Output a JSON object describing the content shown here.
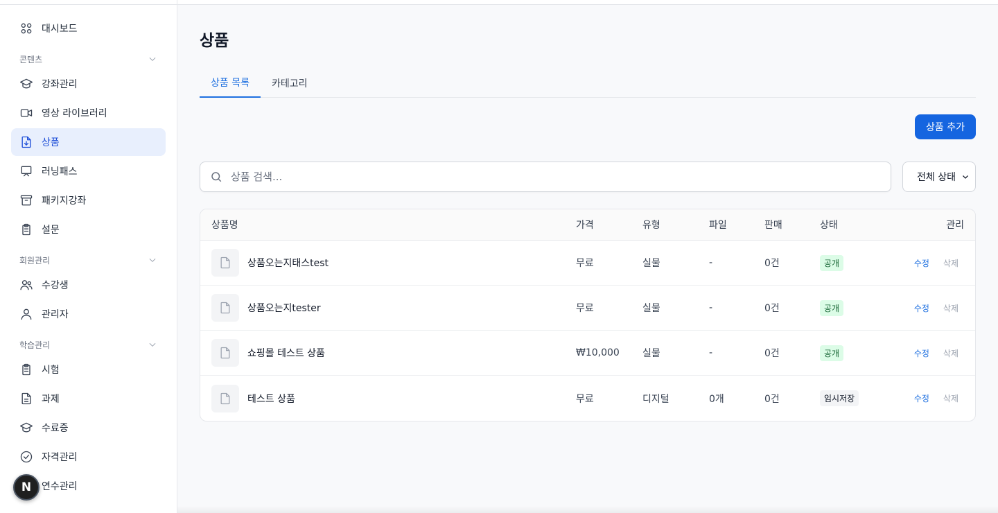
{
  "sidebar": {
    "items": [
      {
        "type": "item",
        "label": "대시보드",
        "icon": "dashboard-grid-icon",
        "name": "sidebar-item-dashboard",
        "active": false
      },
      {
        "type": "section",
        "label": "콘텐츠",
        "name": "section-content"
      },
      {
        "type": "item",
        "label": "강좌관리",
        "icon": "graduation-cap-icon",
        "name": "sidebar-item-courses",
        "active": false
      },
      {
        "type": "item",
        "label": "영상 라이브러리",
        "icon": "video-camera-icon",
        "name": "sidebar-item-video-library",
        "active": false
      },
      {
        "type": "item",
        "label": "상품",
        "icon": "file-download-icon",
        "name": "sidebar-item-products",
        "active": true
      },
      {
        "type": "item",
        "label": "러닝패스",
        "icon": "presentation-board-icon",
        "name": "sidebar-item-learning-path",
        "active": false
      },
      {
        "type": "item",
        "label": "패키지강좌",
        "icon": "archive-box-icon",
        "name": "sidebar-item-package-courses",
        "active": false
      },
      {
        "type": "item",
        "label": "설문",
        "icon": "clipboard-icon",
        "name": "sidebar-item-survey",
        "active": false
      },
      {
        "type": "section",
        "label": "회원관리",
        "name": "section-members"
      },
      {
        "type": "item",
        "label": "수강생",
        "icon": "users-icon",
        "name": "sidebar-item-students",
        "active": false
      },
      {
        "type": "item",
        "label": "관리자",
        "icon": "user-icon",
        "name": "sidebar-item-admins",
        "active": false
      },
      {
        "type": "section",
        "label": "학습관리",
        "name": "section-learning"
      },
      {
        "type": "item",
        "label": "시험",
        "icon": "clipboard-icon",
        "name": "sidebar-item-exam",
        "active": false
      },
      {
        "type": "item",
        "label": "과제",
        "icon": "file-text-icon",
        "name": "sidebar-item-assignment",
        "active": false
      },
      {
        "type": "item",
        "label": "수료증",
        "icon": "graduation-cap-icon",
        "name": "sidebar-item-certificate",
        "active": false
      },
      {
        "type": "item",
        "label": "자격관리",
        "icon": "check-circle-icon",
        "name": "sidebar-item-qualification",
        "active": false
      },
      {
        "type": "item",
        "label": "연수관리",
        "icon": "calendar-icon",
        "name": "sidebar-item-training",
        "active": false
      }
    ],
    "badge_letter": "N"
  },
  "page": {
    "title": "상품",
    "tabs": [
      {
        "label": "상품 목록",
        "active": true
      },
      {
        "label": "카테고리",
        "active": false
      }
    ],
    "add_button": "상품 추가",
    "search_placeholder": "상품 검색...",
    "status_filter": "전체 상태"
  },
  "table": {
    "headers": {
      "name": "상품명",
      "price": "가격",
      "type": "유형",
      "file": "파일",
      "sales": "판매",
      "status": "상태",
      "manage": "관리"
    },
    "rows": [
      {
        "name": "상품오는지태스test",
        "price": "무료",
        "type": "실물",
        "file": "-",
        "sales": "0건",
        "status": "공개",
        "status_kind": "public",
        "edit": "수정",
        "delete": "삭제"
      },
      {
        "name": "상품오는지tester",
        "price": "무료",
        "type": "실물",
        "file": "-",
        "sales": "0건",
        "status": "공개",
        "status_kind": "public",
        "edit": "수정",
        "delete": "삭제"
      },
      {
        "name": "쇼핑몰 테스트 상품",
        "price": "₩10,000",
        "type": "실물",
        "file": "-",
        "sales": "0건",
        "status": "공개",
        "status_kind": "public",
        "edit": "수정",
        "delete": "삭제"
      },
      {
        "name": "테스트 상품",
        "price": "무료",
        "type": "디지털",
        "file": "0개",
        "sales": "0건",
        "status": "임시저장",
        "status_kind": "draft",
        "edit": "수정",
        "delete": "삭제"
      }
    ]
  },
  "colors": {
    "accent": "#1565e0",
    "active_bg": "#e8effd",
    "public_badge_bg": "#dcfce7",
    "draft_badge_bg": "#f3f4f6"
  }
}
